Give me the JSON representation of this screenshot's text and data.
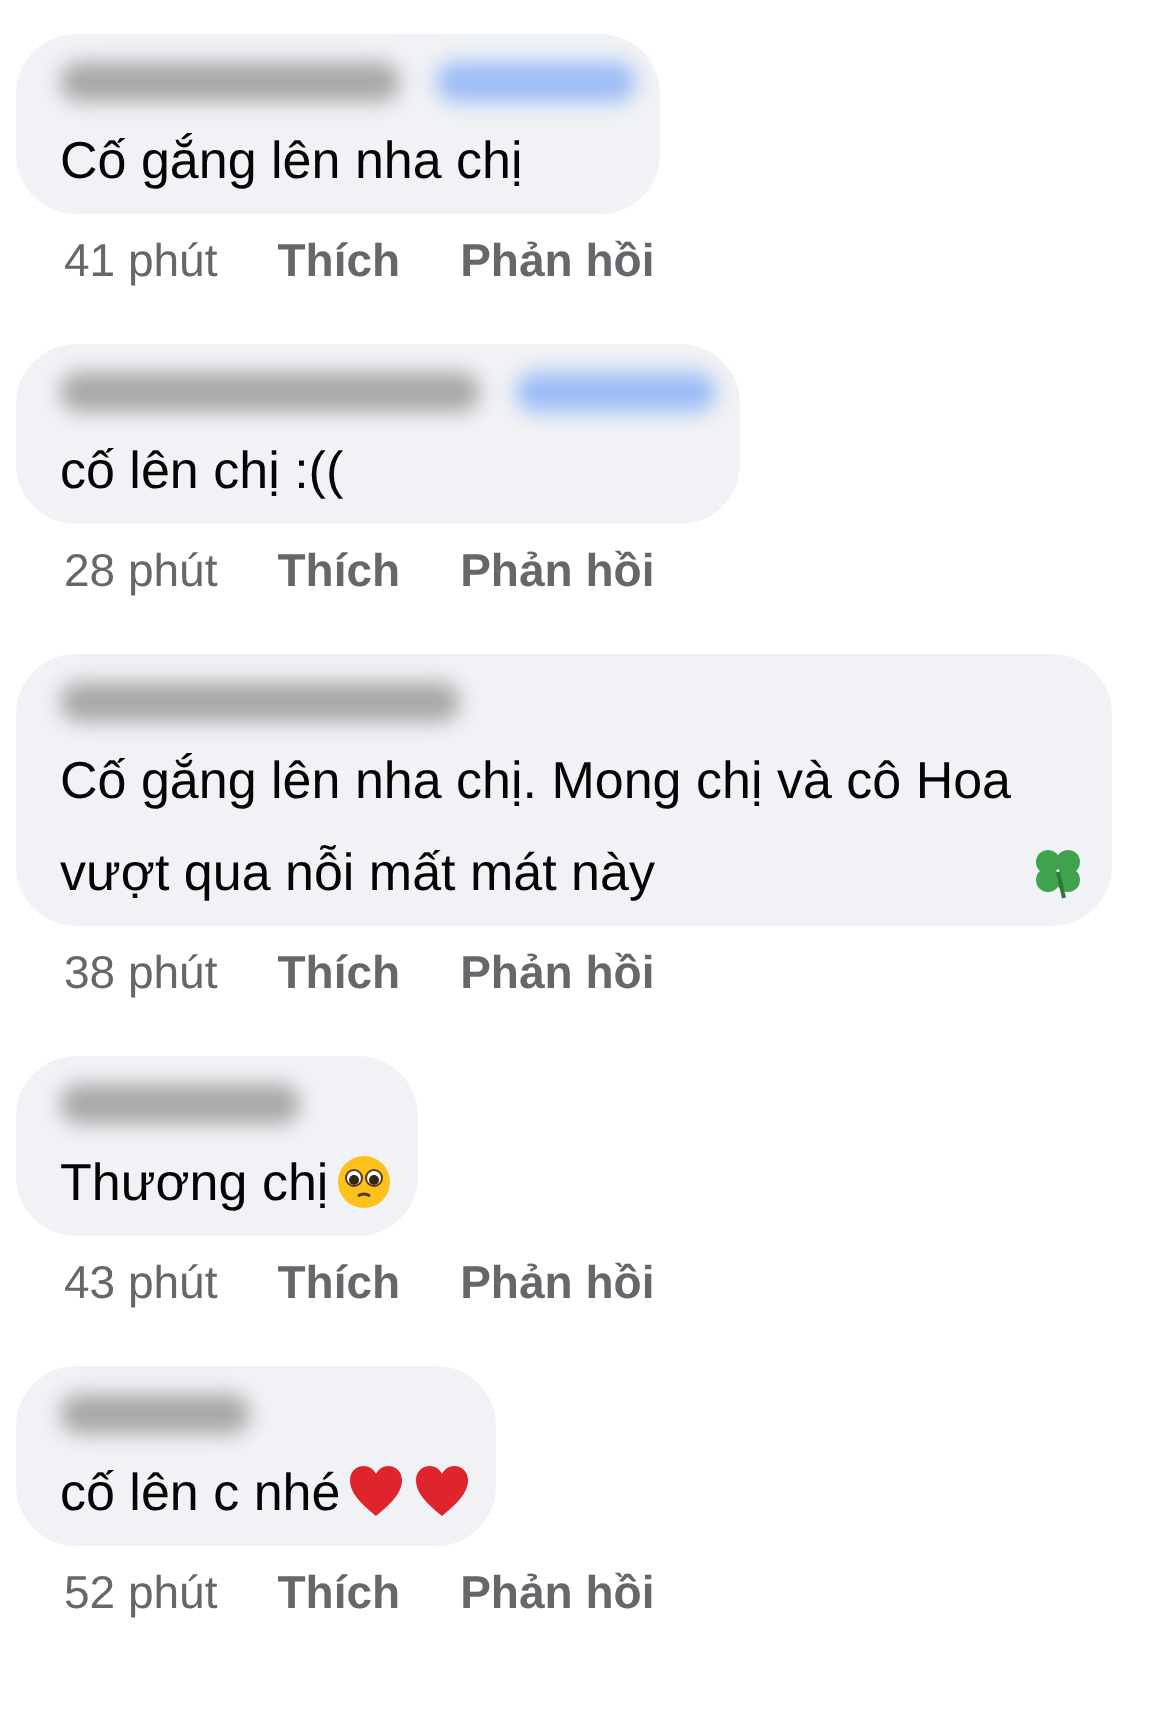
{
  "comments": [
    {
      "follow_blurred": true,
      "text": "Cố gắng lên nha chị",
      "time": "41 phút",
      "like": "Thích",
      "reply": "Phản hồi"
    },
    {
      "follow_blurred": true,
      "text": "cố lên chị :((",
      "time": "28 phút",
      "like": "Thích",
      "reply": "Phản hồi"
    },
    {
      "follow_blurred": false,
      "text": "Cố gắng lên nha chị. Mong chị và cô Hoa vượt qua nỗi mất mát này",
      "icons": [
        {
          "kind": "clover"
        }
      ],
      "time": "38 phút",
      "like": "Thích",
      "reply": "Phản hồi"
    },
    {
      "follow_blurred": false,
      "text": "Thương chị",
      "icons": [
        {
          "kind": "pleading"
        }
      ],
      "time": "43 phút",
      "like": "Thích",
      "reply": "Phản hồi"
    },
    {
      "follow_blurred": false,
      "text": "cố lên c nhé",
      "icons": [
        {
          "kind": "heart"
        },
        {
          "kind": "heart"
        }
      ],
      "time": "52 phút",
      "like": "Thích",
      "reply": "Phản hồi"
    }
  ]
}
